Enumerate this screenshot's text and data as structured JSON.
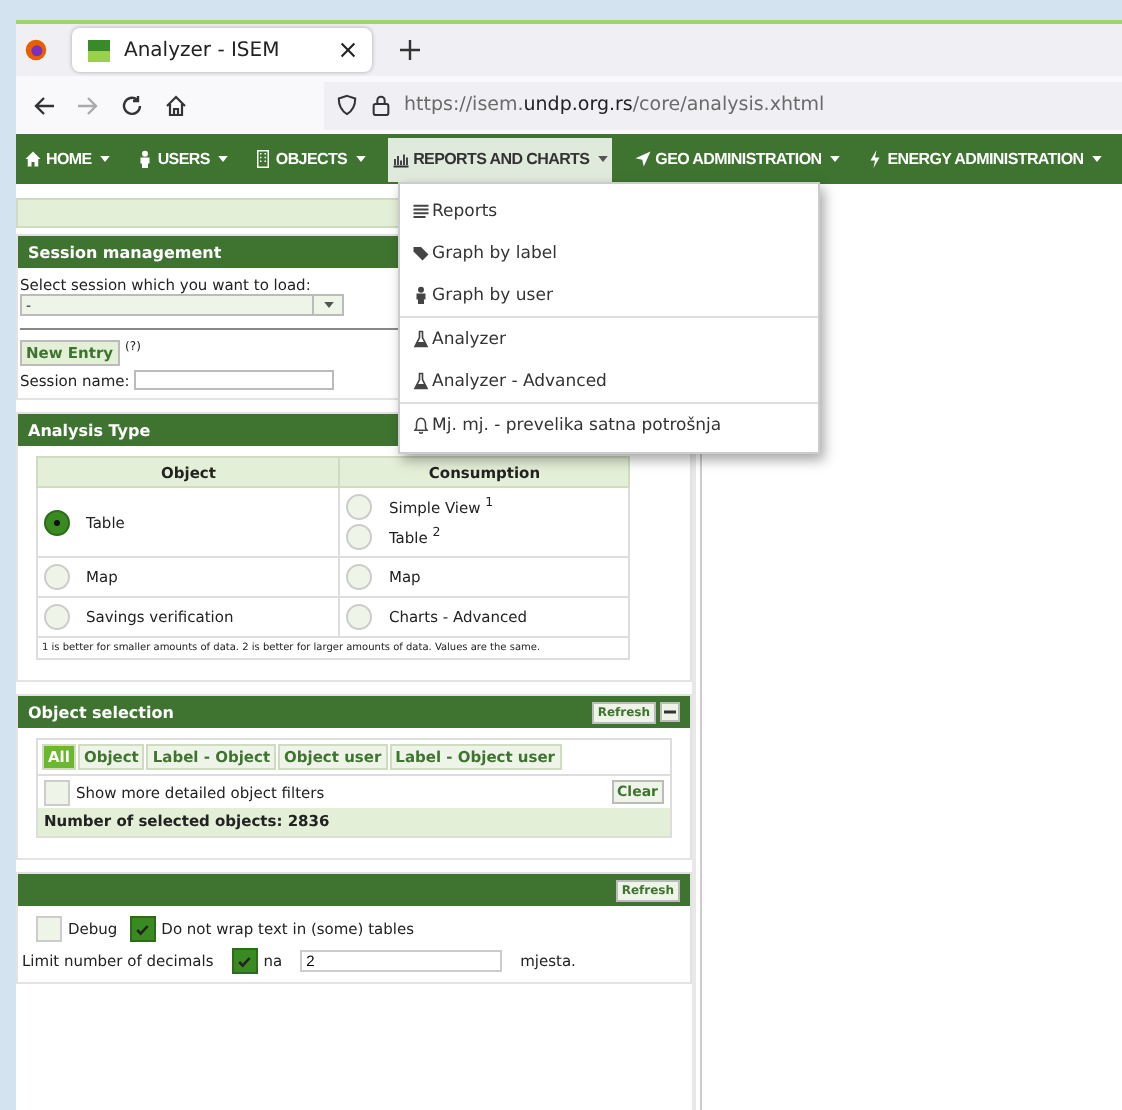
{
  "browser": {
    "tab_title": "Analyzer - ISEM",
    "url_prefix": "https://isem.",
    "url_domain": "undp.org.rs",
    "url_path": "/core/analysis.xhtml"
  },
  "nav": [
    {
      "label": "HOME",
      "kind": "home",
      "selected": false
    },
    {
      "label": "USERS",
      "kind": "user",
      "selected": false
    },
    {
      "label": "OBJECTS",
      "kind": "building",
      "selected": false
    },
    {
      "label": "REPORTS AND CHARTS",
      "kind": "chart",
      "selected": true
    },
    {
      "label": "GEO ADMINISTRATION",
      "kind": "arrow",
      "selected": false
    },
    {
      "label": "ENERGY ADMINISTRATION",
      "kind": "bolt",
      "selected": false
    }
  ],
  "dropdown": [
    [
      {
        "label": "Reports",
        "kind": "list"
      },
      {
        "label": "Graph by label",
        "kind": "tag"
      },
      {
        "label": "Graph by user",
        "kind": "user"
      }
    ],
    [
      {
        "label": "Analyzer",
        "kind": "flask"
      },
      {
        "label": "Analyzer - Advanced",
        "kind": "flask"
      }
    ],
    [
      {
        "label": "Mj. mj. - prevelika satna potrošnja",
        "kind": "bell"
      }
    ]
  ],
  "session": {
    "title": "Session management",
    "select_label": "Select session which you want to load:",
    "select_value": "-",
    "new_entry": "New Entry",
    "help": "(?)",
    "name_label": "Session name:"
  },
  "analysis": {
    "title": "Analysis Type",
    "columns": [
      "Object",
      "Consumption"
    ],
    "rows": [
      {
        "object": [
          {
            "label": "Table",
            "selected": true
          }
        ],
        "consumption": [
          {
            "label": "Simple View $^{1}$",
            "selected": false
          },
          {
            "label": "Table $^{2}$",
            "selected": false
          }
        ]
      },
      {
        "object": [
          {
            "label": "Map",
            "selected": false
          }
        ],
        "consumption": [
          {
            "label": "Map",
            "selected": false
          }
        ]
      },
      {
        "object": [
          {
            "label": "Savings verification",
            "selected": false
          }
        ],
        "consumption": [
          {
            "label": "Charts - Advanced",
            "selected": false
          }
        ]
      }
    ],
    "note": "1 is better for smaller amounts of data. 2 is better for larger amounts of data. Values are the same."
  },
  "object_selection": {
    "title": "Object selection",
    "refresh": "Refresh",
    "filters": [
      {
        "label": "All",
        "selected": true
      },
      {
        "label": "Object",
        "selected": false
      },
      {
        "label": "Label - Object",
        "selected": false
      },
      {
        "label": "Object user",
        "selected": false
      },
      {
        "label": "Label - Object user",
        "selected": false
      }
    ],
    "detail_label": "Show more detailed object filters",
    "detail_checked": false,
    "clear": "Clear",
    "count": "Number of selected objects: 2836"
  },
  "options": {
    "refresh": "Refresh",
    "checks": [
      {
        "label": "Debug",
        "checked": false
      },
      {
        "label": "Do not wrap text in (some) tables",
        "checked": true
      }
    ],
    "decimals_label": "Limit number of decimals",
    "decimals_checked": true,
    "na": "na",
    "decimals_value": "2",
    "suffix": "mjesta."
  }
}
